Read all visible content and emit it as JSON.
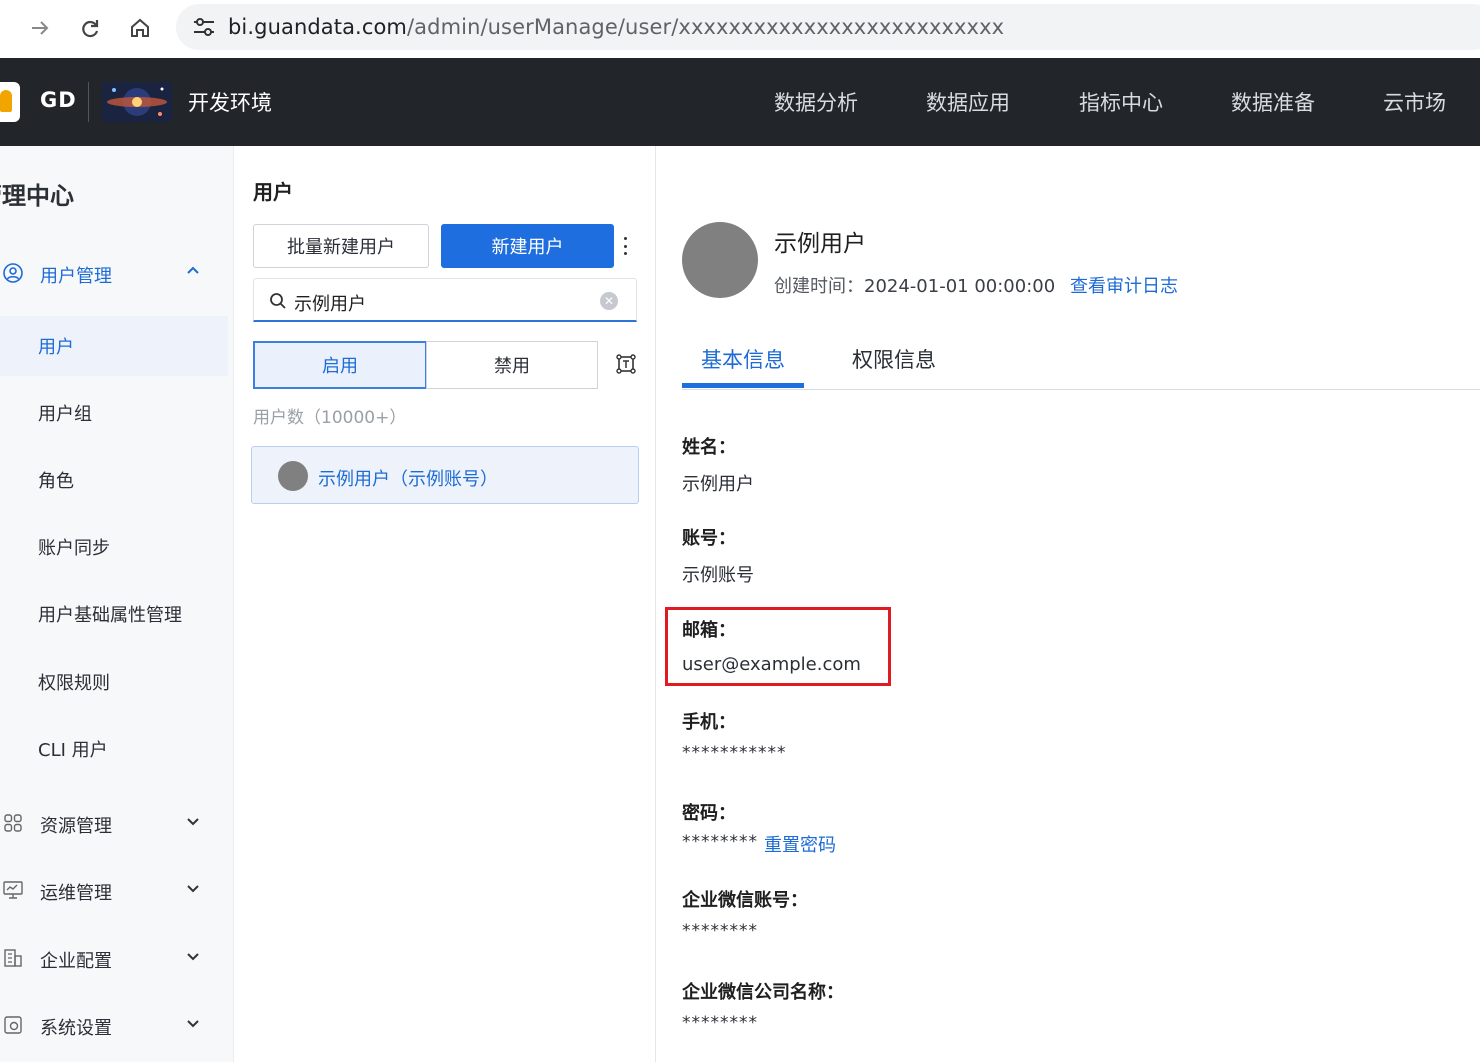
{
  "browser": {
    "url_host": "bi.guandata.com",
    "url_path": "/admin/userManage/user/xxxxxxxxxxxxxxxxxxxxxxxxxx"
  },
  "header": {
    "brand": "GD",
    "env_name": "开发环境",
    "nav": [
      "数据分析",
      "数据应用",
      "指标中心",
      "数据准备",
      "云市场"
    ]
  },
  "sidebar": {
    "title": "管理中心",
    "groups": [
      {
        "label": "用户管理",
        "icon": "user-circle-icon",
        "expanded": true
      },
      {
        "label": "资源管理",
        "icon": "grid-icon"
      },
      {
        "label": "运维管理",
        "icon": "monitor-icon"
      },
      {
        "label": "企业配置",
        "icon": "building-icon"
      },
      {
        "label": "系统设置",
        "icon": "settings-icon"
      }
    ],
    "user_items": [
      "用户",
      "用户组",
      "角色",
      "账户同步",
      "用户基础属性管理",
      "权限规则",
      "CLI 用户"
    ],
    "selected_item": "用户"
  },
  "users_panel": {
    "title": "用户",
    "batch_create": "批量新建用户",
    "create": "新建用户",
    "search_value": "示例用户",
    "seg_enabled": "启用",
    "seg_disabled": "禁用",
    "count_text": "用户数（10000+）",
    "result_label": "示例用户（示例账号）"
  },
  "detail": {
    "name": "示例用户",
    "created_label": "创建时间：",
    "created_value": "2024-01-01 00:00:00",
    "audit_link": "查看审计日志",
    "tabs": [
      "基本信息",
      "权限信息"
    ],
    "fields": [
      {
        "label": "姓名：",
        "value": "示例用户"
      },
      {
        "label": "账号：",
        "value": "示例账号"
      },
      {
        "label": "邮箱：",
        "value": "user@example.com"
      },
      {
        "label": "手机：",
        "value": "***********"
      },
      {
        "label": "密码：",
        "value": "********"
      },
      {
        "label": "企业微信账号：",
        "value": "********"
      },
      {
        "label": "企业微信公司名称：",
        "value": "********"
      }
    ],
    "reset_password": "重置密码"
  },
  "colors": {
    "accent": "#1f6ee0",
    "header_bg": "#22262b",
    "highlight": "#e01b22"
  }
}
